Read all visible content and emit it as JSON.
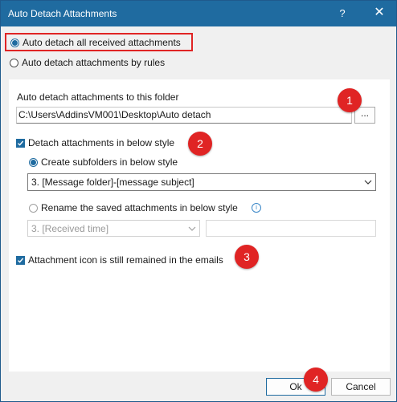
{
  "window": {
    "title": "Auto Detach Attachments",
    "help_label": "?",
    "close_label": "✕"
  },
  "mode": {
    "option_all": "Auto detach all received attachments",
    "option_rules": "Auto detach attachments by rules",
    "selected": "all"
  },
  "folder": {
    "label": "Auto detach attachments to this folder",
    "path": "C:\\Users\\AddinsVM001\\Desktop\\Auto detach",
    "browse_label": "..."
  },
  "detach_style": {
    "checkbox_label": "Detach attachments in below style",
    "checked": true,
    "subfolders_label": "Create subfolders in below style",
    "subfolder_style": "3. [Message folder]-[message subject]",
    "rename_label": "Rename the saved attachments in below style",
    "rename_style": "3. [Received time]",
    "rename_text": ""
  },
  "icon_remained": {
    "checkbox_label": "Attachment icon is still remained in the emails",
    "checked": true
  },
  "badges": [
    "1",
    "2",
    "3",
    "4"
  ],
  "buttons": {
    "ok_label": "Ok",
    "cancel_label": "Cancel"
  },
  "colors": {
    "titlebar": "#1f6ba0",
    "accent": "#1f6ba0",
    "badge": "#e02424",
    "highlight_border": "#e02424"
  }
}
